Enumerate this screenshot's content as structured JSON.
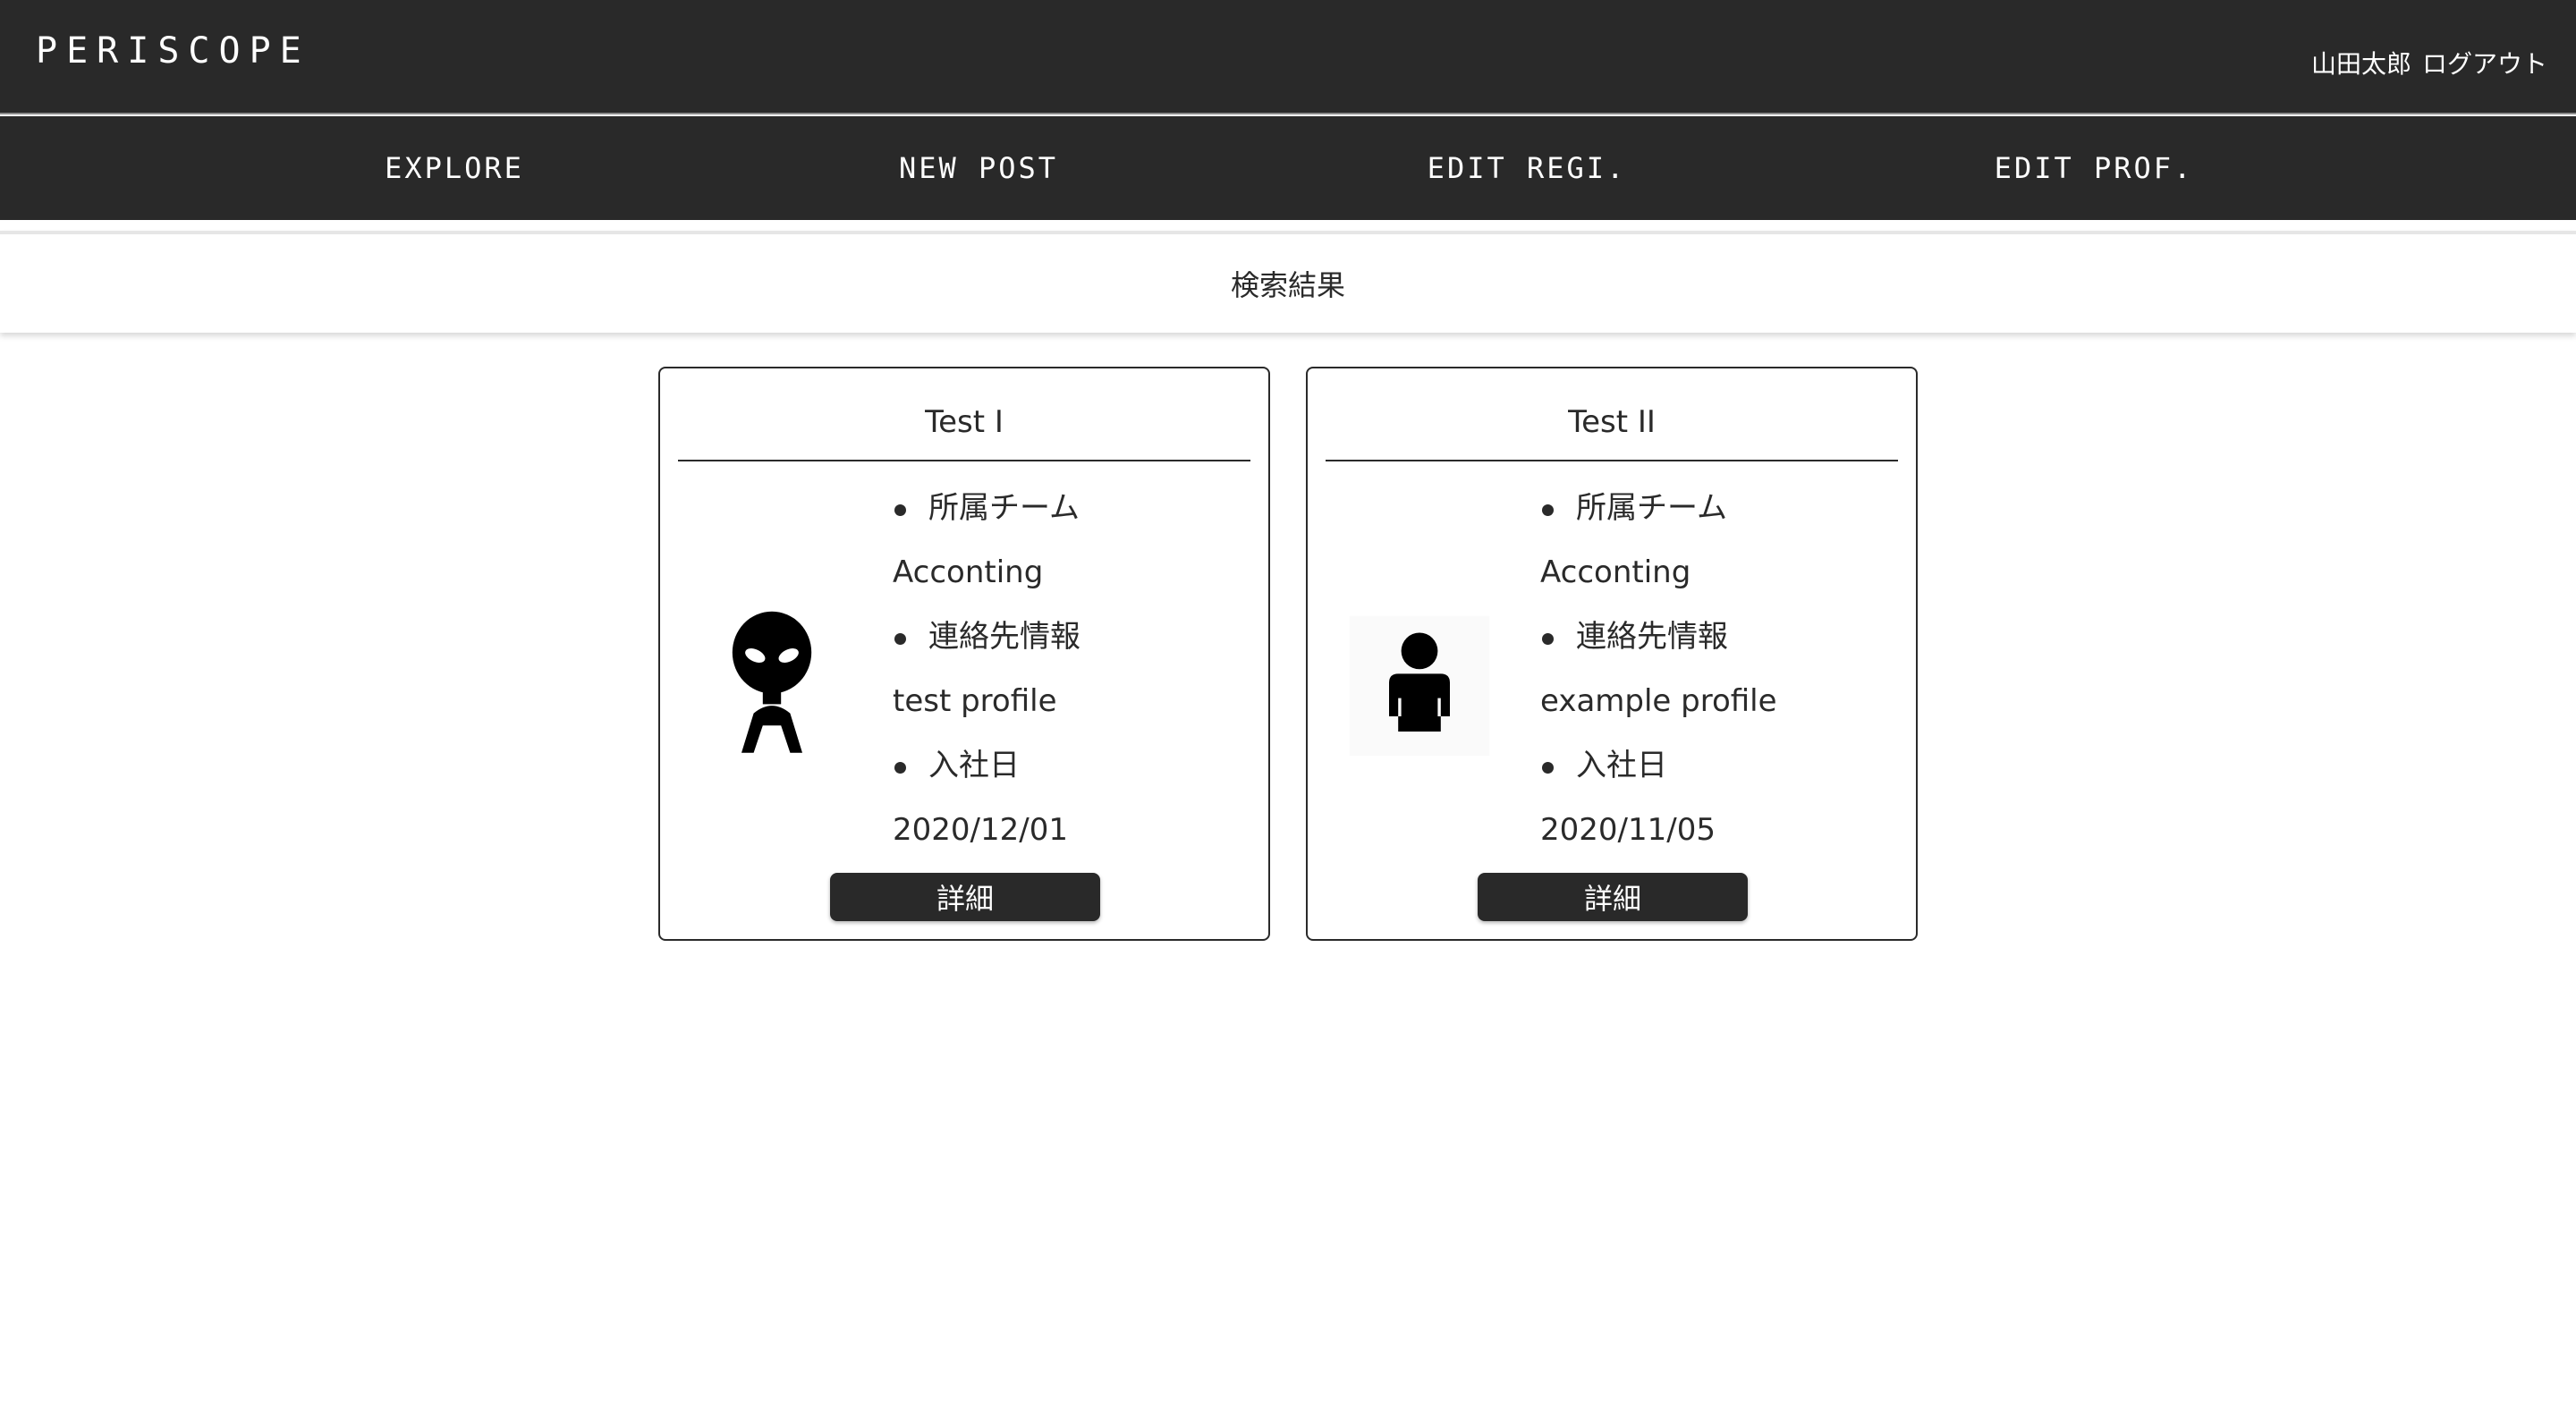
{
  "header": {
    "brand": "PERISCOPE",
    "user_name": "山田太郎",
    "logout_label": "ログアウト"
  },
  "nav": {
    "explore": "EXPLORE",
    "new_post": "NEW POST",
    "edit_regi": "EDIT REGI.",
    "edit_prof": "EDIT PROF."
  },
  "results": {
    "title": "検索結果"
  },
  "cards": [
    {
      "name": "Test I",
      "avatar_icon": "alien-icon",
      "team_label": "所属チーム",
      "team_value": "Acconting",
      "contact_label": "連絡先情報",
      "contact_value": "test profile",
      "join_label": "入社日",
      "join_value": "2020/12/01",
      "detail_label": "詳細"
    },
    {
      "name": "Test II",
      "avatar_icon": "person-icon",
      "team_label": "所属チーム",
      "team_value": "Acconting",
      "contact_label": "連絡先情報",
      "contact_value": "example profile",
      "join_label": "入社日",
      "join_value": "2020/11/05",
      "detail_label": "詳細"
    }
  ]
}
